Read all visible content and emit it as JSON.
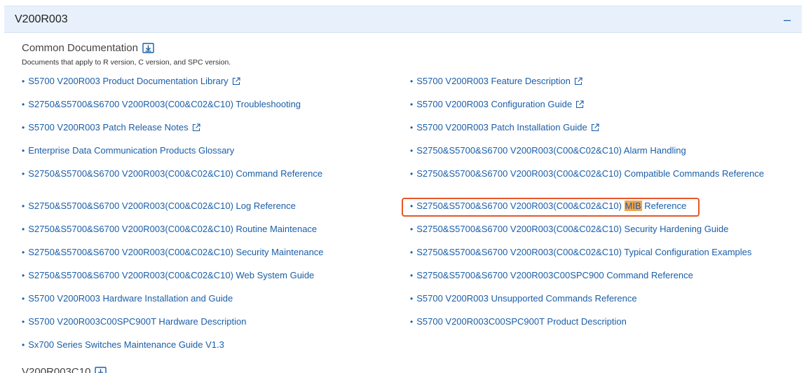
{
  "panel": {
    "title": "V200R003",
    "collapse_symbol": "–"
  },
  "section": {
    "title": "Common Documentation",
    "description": "Documents that apply to R version, C version, and SPC version."
  },
  "links_left": [
    {
      "text": "S5700 V200R003 Product Documentation Library",
      "external": true
    },
    {
      "text": "S2750&S5700&S6700 V200R003(C00&C02&C10) Troubleshooting",
      "external": false
    },
    {
      "text": "S5700 V200R003 Patch Release Notes",
      "external": true
    },
    {
      "text": "Enterprise Data Communication Products Glossary",
      "external": false
    },
    {
      "text": "S2750&S5700&S6700 V200R003(C00&C02&C10) Command Reference",
      "external": false
    },
    {
      "text": "S2750&S5700&S6700 V200R003(C00&C02&C10) Log Reference",
      "external": false
    },
    {
      "text": "S2750&S5700&S6700 V200R003(C00&C02&C10) Routine Maintenace",
      "external": false
    },
    {
      "text": "S2750&S5700&S6700 V200R003(C00&C02&C10) Security Maintenance",
      "external": false
    },
    {
      "text": "S2750&S5700&S6700 V200R003(C00&C02&C10) Web System Guide",
      "external": false
    },
    {
      "text": "S5700 V200R003 Hardware Installation and Guide",
      "external": false
    },
    {
      "text": "S5700 V200R003C00SPC900T Hardware Description",
      "external": false
    },
    {
      "text": "Sx700 Series Switches Maintenance Guide V1.3",
      "external": false
    }
  ],
  "links_right": [
    {
      "text": "S5700 V200R003 Feature Description",
      "external": true
    },
    {
      "text": "S5700 V200R003 Configuration Guide",
      "external": true
    },
    {
      "text": "S5700 V200R003 Patch Installation Guide",
      "external": true
    },
    {
      "text": "S2750&S5700&S6700 V200R003(C00&C02&C10) Alarm Handling",
      "external": false
    },
    {
      "text": "S2750&S5700&S6700 V200R003(C00&C02&C10) Compatible Commands Reference",
      "external": false
    },
    {
      "text_before": "S2750&S5700&S6700 V200R003(C00&C02&C10) ",
      "highlight": "MIB",
      "text_after": " Reference",
      "external": false
    },
    {
      "text": "S2750&S5700&S6700 V200R003(C00&C02&C10) Security Hardening Guide",
      "external": false
    },
    {
      "text": "S2750&S5700&S6700 V200R003(C00&C02&C10) Typical Configuration Examples",
      "external": false
    },
    {
      "text": "S2750&S5700&S6700 V200R003C00SPC900 Command Reference",
      "external": false
    },
    {
      "text": "S5700 V200R003 Unsupported Commands Reference",
      "external": false
    },
    {
      "text": "S5700 V200R003C00SPC900T Product Description",
      "external": false
    }
  ],
  "next_section": {
    "title": "V200R003C10"
  },
  "colors": {
    "link": "#1a5ea8",
    "header_bg": "#e8f1fb",
    "highlight": "#f5a54a",
    "box_border": "#e8562a"
  },
  "icons": {
    "download": "download-icon",
    "external": "external-link-icon"
  }
}
